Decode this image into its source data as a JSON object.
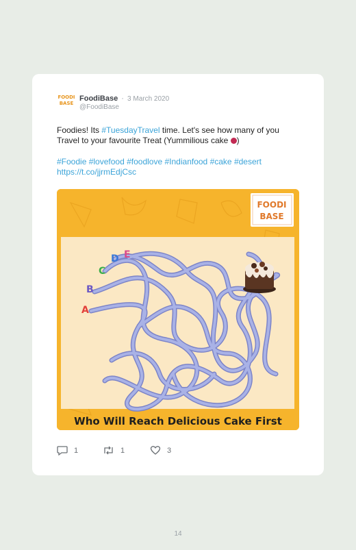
{
  "tweet": {
    "avatar_line1": "FOODI",
    "avatar_line2": "BASE",
    "author_name": "FoodiBase",
    "separator": "·",
    "date": "3 March 2020",
    "handle": "@FoodiBase",
    "text_part1": "Foodies! Its ",
    "text_hashtag": "#TuesdayTravel",
    "text_part2": " time. Let's see how many of you Travel to your favourite Treat (Yummilious cake ",
    "text_part3": ")",
    "hashtags": [
      "#Foodie",
      "#lovefood",
      "#foodlove",
      "#Indianfood",
      "#cake",
      "#desert"
    ],
    "link": "https://t.co/jjrmEdjCsc"
  },
  "media": {
    "logo_line1": "FOODI",
    "logo_line2": "BASE",
    "maze_labels": [
      "A",
      "B",
      "C",
      "D",
      "E"
    ],
    "maze_label_colors": [
      "#e2403a",
      "#6b58c4",
      "#3cae4a",
      "#3a78d8",
      "#d84a8a"
    ],
    "caption": "Who Will Reach Delicious Cake First",
    "bg_color": "#f6b42c",
    "path_color": "#a9b2e6"
  },
  "actions": {
    "reply_count": "1",
    "retweet_count": "1",
    "like_count": "3"
  },
  "page_number": "14"
}
